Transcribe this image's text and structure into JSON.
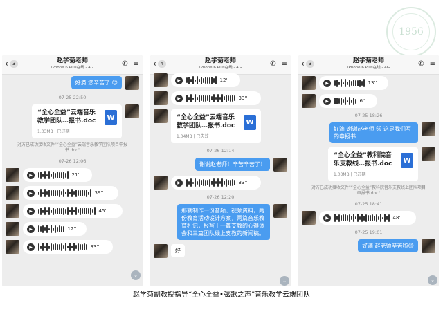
{
  "seal": {
    "text": "1956"
  },
  "caption": "赵学菊副教授指导“全心全益•弦歌之声”音乐教学云端团队",
  "panel1": {
    "back_count": "3",
    "title": "赵学菊老师",
    "subtitle": "iPhone 6 Plus在线 - 4G",
    "top_bubble": "好滴 您辛苦了 😊",
    "time1": "07-25 22:50",
    "file_name": "“全心全益”云端音乐教学团队…报书.doc",
    "file_meta": "1.03MB | 已过期",
    "sys_note": "对方已成功接收文件\"“全心全益”云端音乐教学团队项目申报书.doc\"",
    "time2": "07-26 12:06",
    "voice_durations": [
      "21''",
      "39''",
      "45''",
      "12''",
      "33''"
    ]
  },
  "panel2": {
    "back_count": "4",
    "title": "赵学菊老师",
    "subtitle": "iPhone 6 Plus在线 - 4G",
    "voice_top1": "12''",
    "voice_top2": "33''",
    "file_name": "“全心全益”云端音乐教学团队…报书.doc",
    "file_meta": "1.04MB | 已失效",
    "time1": "07-26 12:14",
    "thanks_bubble": "谢谢赵老师！辛苦辛苦了！",
    "voice_mid": "33''",
    "time2": "07-26 12:20",
    "long_bubble": "那就制作一份音频、视频资料，两份教育活动设计方案，两篇音乐教育札记，报写十一篇支教的心得体会和三篇团队线上支教的新闻稿。",
    "reply_bubble": "好"
  },
  "panel3": {
    "back_count": "3",
    "title": "赵学菊老师",
    "subtitle": "iPhone 6 Plus在线 - 4G",
    "voice_top1": "13''",
    "voice_top2": "6''",
    "time1": "07-25 18:26",
    "sent_bubble": "好滴 谢谢赵老师 🐱 这是我们写的申报书",
    "file_name": "“全心全益”教科院音乐支教线…报书.doc",
    "file_meta": "1.03MB | 已过期",
    "sys_note": "对方已成功接收文件\"“全心全益”教科院音乐支教线上团队项目申报书.doc\"",
    "time2": "07-25 18:41",
    "voice_bottom": "48''",
    "time3": "07-25 19:01",
    "last_bubble": "好滴 赵老师辛苦啦😊"
  },
  "icons": {
    "back": "chevron-left-icon",
    "phone": "phone-icon",
    "menu": "menu-icon",
    "play": "play-icon",
    "word": "word-document-icon",
    "down": "scroll-down-icon"
  }
}
